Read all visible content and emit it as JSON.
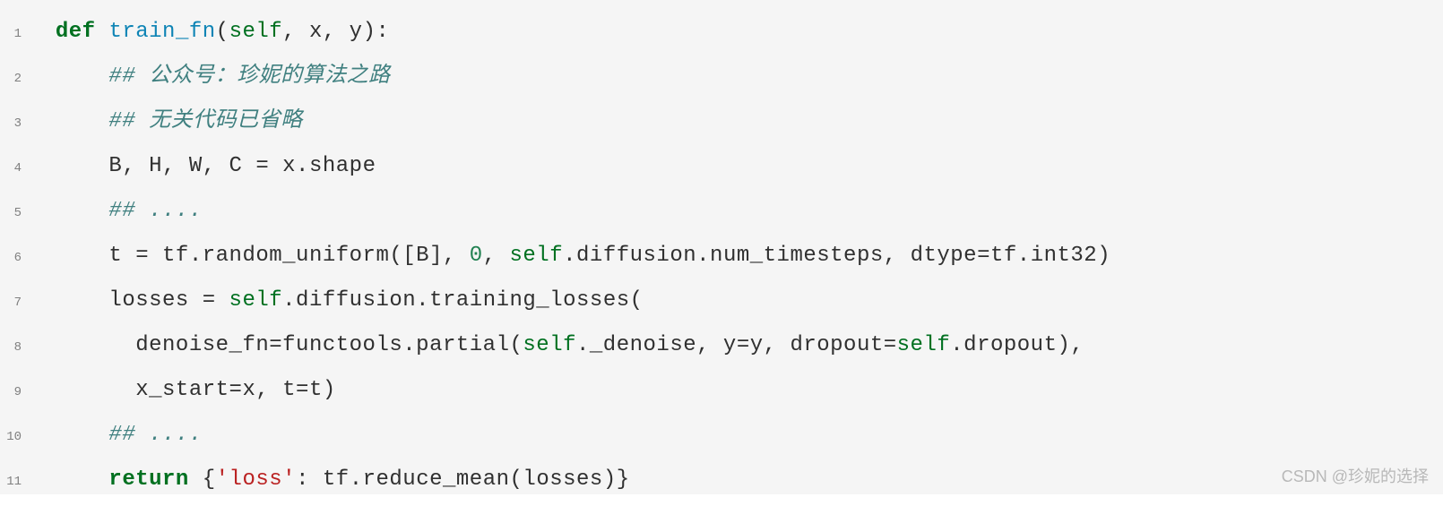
{
  "lines": [
    {
      "num": "1",
      "tokens": [
        {
          "cls": "plain",
          "t": "  "
        },
        {
          "cls": "kw",
          "t": "def"
        },
        {
          "cls": "plain",
          "t": " "
        },
        {
          "cls": "fn",
          "t": "train_fn"
        },
        {
          "cls": "plain",
          "t": "("
        },
        {
          "cls": "self",
          "t": "self"
        },
        {
          "cls": "plain",
          "t": ", x, y):"
        }
      ]
    },
    {
      "num": "2",
      "tokens": [
        {
          "cls": "plain",
          "t": "      "
        },
        {
          "cls": "comment",
          "t": "## 公众号：珍妮的算法之路"
        }
      ]
    },
    {
      "num": "3",
      "tokens": [
        {
          "cls": "plain",
          "t": "      "
        },
        {
          "cls": "comment",
          "t": "## 无关代码已省略"
        }
      ]
    },
    {
      "num": "4",
      "tokens": [
        {
          "cls": "plain",
          "t": "      B, H, W, C "
        },
        {
          "cls": "plain",
          "t": "= "
        },
        {
          "cls": "plain",
          "t": "x.shape"
        }
      ]
    },
    {
      "num": "5",
      "tokens": [
        {
          "cls": "plain",
          "t": "      "
        },
        {
          "cls": "comment",
          "t": "## ...."
        }
      ]
    },
    {
      "num": "6",
      "tokens": [
        {
          "cls": "plain",
          "t": "      t = tf.random_uniform([B], "
        },
        {
          "cls": "num",
          "t": "0"
        },
        {
          "cls": "plain",
          "t": ", "
        },
        {
          "cls": "self",
          "t": "self"
        },
        {
          "cls": "plain",
          "t": ".diffusion.num_timesteps, dtype=tf.int32)"
        }
      ]
    },
    {
      "num": "7",
      "tokens": [
        {
          "cls": "plain",
          "t": "      losses = "
        },
        {
          "cls": "self",
          "t": "self"
        },
        {
          "cls": "plain",
          "t": ".diffusion.training_losses("
        }
      ]
    },
    {
      "num": "8",
      "tokens": [
        {
          "cls": "plain",
          "t": "        denoise_fn=functools.partial("
        },
        {
          "cls": "self",
          "t": "self"
        },
        {
          "cls": "plain",
          "t": "._denoise, y=y, dropout="
        },
        {
          "cls": "self",
          "t": "self"
        },
        {
          "cls": "plain",
          "t": ".dropout),"
        }
      ]
    },
    {
      "num": "9",
      "tokens": [
        {
          "cls": "plain",
          "t": "        x_start=x, t=t)"
        }
      ]
    },
    {
      "num": "10",
      "tokens": [
        {
          "cls": "plain",
          "t": "      "
        },
        {
          "cls": "comment",
          "t": "## ...."
        }
      ]
    },
    {
      "num": "11",
      "tokens": [
        {
          "cls": "plain",
          "t": "      "
        },
        {
          "cls": "kw",
          "t": "return"
        },
        {
          "cls": "plain",
          "t": " {"
        },
        {
          "cls": "str",
          "t": "'loss'"
        },
        {
          "cls": "plain",
          "t": ": tf.reduce_mean(losses)}"
        }
      ]
    }
  ],
  "watermark": "CSDN @珍妮的选择"
}
